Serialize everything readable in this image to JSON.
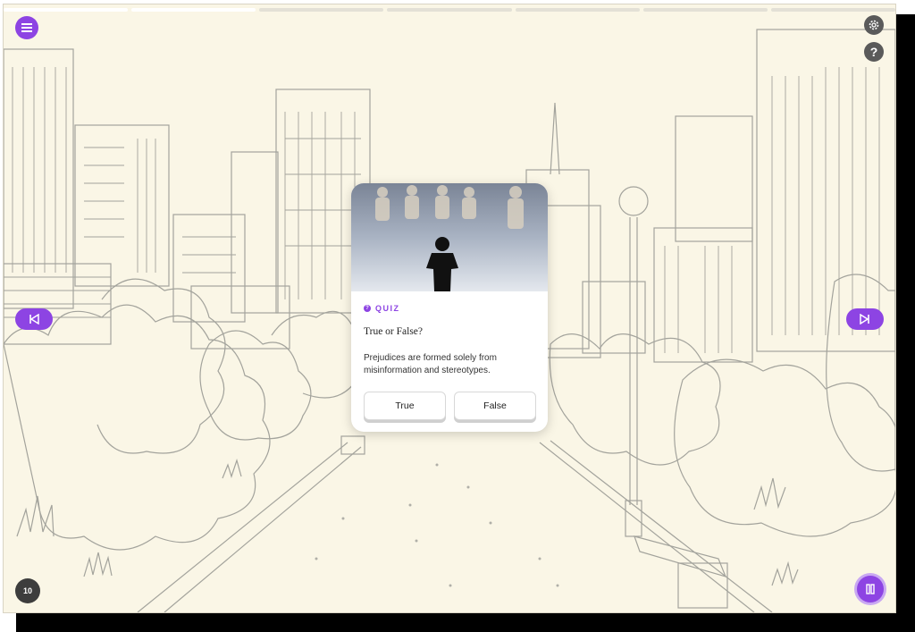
{
  "progress": [
    1,
    1,
    0,
    0,
    0,
    0,
    0
  ],
  "header": {
    "menu_icon": "hamburger-menu-icon",
    "settings_icon": "gear-icon",
    "help_icon": "question-icon",
    "help_label": "?"
  },
  "navigation": {
    "prev_icon": "skip-back-icon",
    "next_icon": "skip-forward-icon"
  },
  "footer": {
    "replay_label": "10",
    "replay_icon": "replay-10-icon",
    "pause_icon": "pause-icon"
  },
  "quiz": {
    "badge": "QUIZ",
    "badge_icon": "question-icon",
    "title": "True or False?",
    "statement": "Prejudices are formed solely from misinformation and stereotypes.",
    "options": [
      "True",
      "False"
    ]
  },
  "colors": {
    "accent": "#8d44e3",
    "background": "#faf6e6",
    "sketch": "#9a9a94"
  }
}
